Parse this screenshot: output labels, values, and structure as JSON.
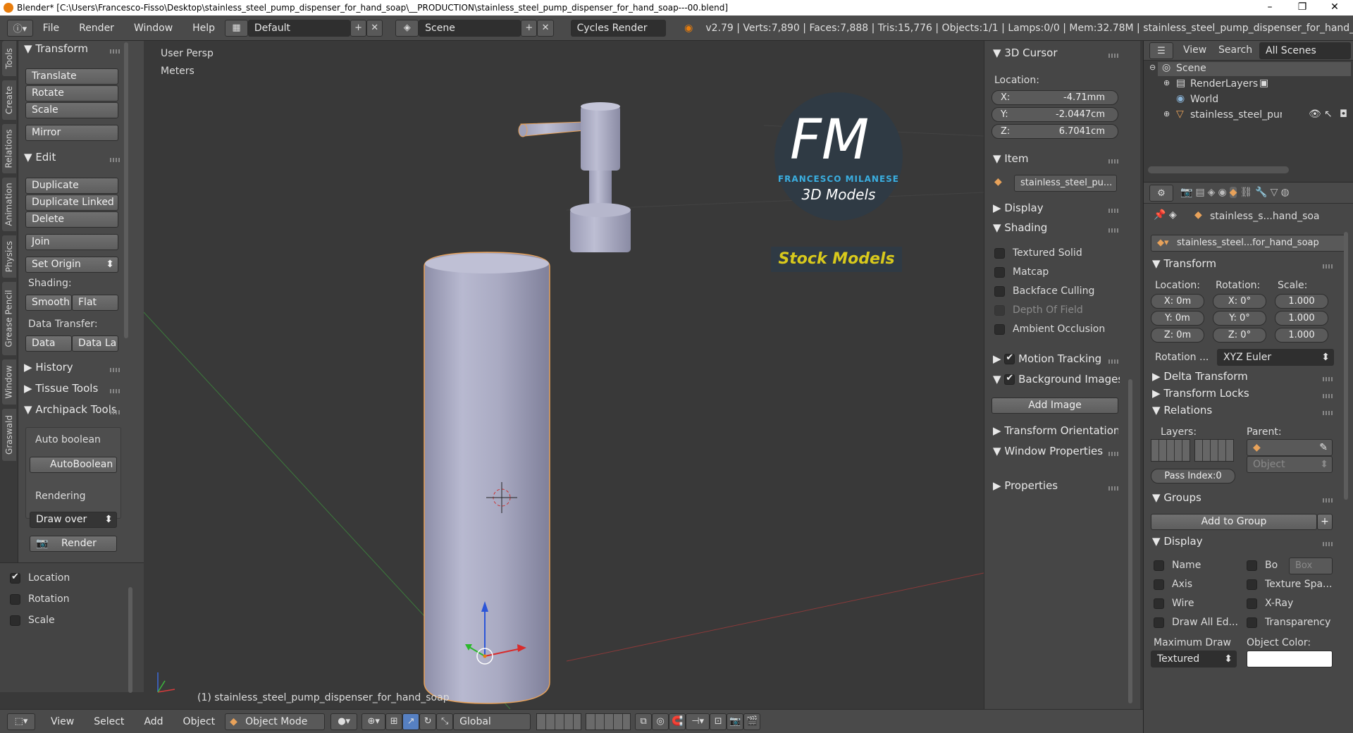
{
  "window": {
    "title": "Blender* [C:\\Users\\Francesco-Fisso\\Desktop\\stainless_steel_pump_dispenser_for_hand_soap\\__PRODUCTION\\stainless_steel_pump_dispenser_for_hand_soap---00.blend]",
    "minimize": "–",
    "maximize": "❐",
    "close": "✕"
  },
  "menu": {
    "file": "File",
    "render": "Render",
    "window": "Window",
    "help": "Help"
  },
  "layout": "Default",
  "scene": "Scene",
  "engine": "Cycles Render",
  "stats": "v2.79 | Verts:7,890 | Faces:7,888 | Tris:15,776 | Objects:1/1 | Lamps:0/0 | Mem:32.78M | stainless_steel_pump_dispenser_for_hand_soap",
  "vtabs": [
    "Tools",
    "Create",
    "Relations",
    "Animation",
    "Physics",
    "Grease Pencil",
    "Window",
    "Graswald"
  ],
  "tools": {
    "transform": "Transform",
    "translate": "Translate",
    "rotate": "Rotate",
    "scale": "Scale",
    "mirror": "Mirror",
    "edit": "Edit",
    "duplicate": "Duplicate",
    "duplicate_linked": "Duplicate Linked",
    "delete": "Delete",
    "join": "Join",
    "set_origin": "Set Origin",
    "shading": "Shading:",
    "smooth": "Smooth",
    "flat": "Flat",
    "data_transfer": "Data Transfer:",
    "data": "Data",
    "data_la": "Data La",
    "history": "History",
    "tissue": "Tissue Tools",
    "archipack": "Archipack Tools",
    "auto_boolean": "Auto boolean",
    "autoboolean_btn": "AutoBoolean",
    "rendering": "Rendering",
    "draw_over": "Draw over",
    "render": "Render"
  },
  "last_op": {
    "location": "Location",
    "rotation": "Rotation",
    "scale": "Scale"
  },
  "viewport": {
    "persp": "User Persp",
    "units": "Meters",
    "object_label": "(1) stainless_steel_pump_dispenser_for_hand_soap"
  },
  "logo": {
    "letters": "FM",
    "name": "FRANCESCO MILANESE",
    "sub": "3D Models",
    "stock": "Stock Models"
  },
  "npanel": {
    "cursor": "3D Cursor",
    "location": "Location:",
    "x_label": "X:",
    "x": "-4.71mm",
    "y_label": "Y:",
    "y": "-2.0447cm",
    "z_label": "Z:",
    "z": "6.7041cm",
    "item": "Item",
    "item_name": "stainless_steel_pu...",
    "display": "Display",
    "shading": "Shading",
    "textured_solid": "Textured Solid",
    "matcap": "Matcap",
    "backface": "Backface Culling",
    "dof": "Depth Of Field",
    "ao": "Ambient Occlusion",
    "motion": "Motion Tracking",
    "bg_images": "Background Images",
    "add_image": "Add Image",
    "transform_orient": "Transform Orientations",
    "window_props": "Window Properties",
    "properties": "Properties"
  },
  "outliner": {
    "view": "View",
    "search": "Search",
    "all_scenes": "All Scenes",
    "scene": "Scene",
    "render_layers": "RenderLayers",
    "world": "World",
    "object": "stainless_steel_pump_"
  },
  "props": {
    "breadcrumb": "stainless_s...hand_soa",
    "object_name": "stainless_steel...for_hand_soap",
    "transform": "Transform",
    "location": "Location:",
    "rotation": "Rotation:",
    "scale": "Scale:",
    "lx": "X: 0m",
    "ly": "Y: 0m",
    "lz": "Z: 0m",
    "rx": "X:  0°",
    "ry": "Y:  0°",
    "rz": "Z:  0°",
    "sx": "1.000",
    "sy": "1.000",
    "sz": "1.000",
    "rot_mode_label": "Rotation ...",
    "rot_mode": "XYZ Euler",
    "delta": "Delta Transform",
    "locks": "Transform Locks",
    "relations": "Relations",
    "layers": "Layers:",
    "parent": "Parent:",
    "parent_type": "Object",
    "pass_index": "Pass Index:0",
    "groups": "Groups",
    "add_to_group": "Add to Group",
    "display": "Display",
    "name": "Name",
    "bo": "Bo",
    "box": "Box",
    "axis": "Axis",
    "texture_space": "Texture Spa...",
    "wire": "Wire",
    "xray": "X-Ray",
    "draw_all": "Draw All Ed...",
    "transparency": "Transparency",
    "max_draw": "Maximum Draw",
    "textured": "Textured",
    "object_color": "Object Color:"
  },
  "bottom": {
    "view": "View",
    "select": "Select",
    "add": "Add",
    "object": "Object",
    "mode": "Object Mode",
    "orientation": "Global"
  }
}
